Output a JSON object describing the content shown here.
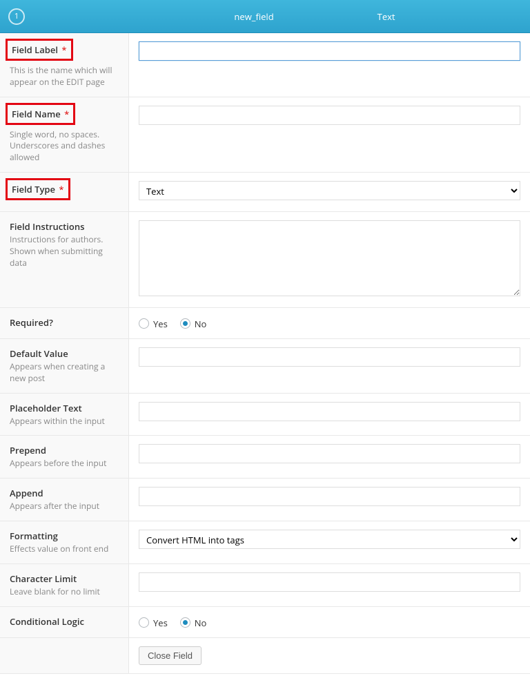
{
  "header": {
    "badge": "1",
    "name_col": "new_field",
    "type_col": "Text"
  },
  "rows": {
    "field_label": {
      "title": "Field Label",
      "required": "*",
      "desc": "This is the name which will appear on the EDIT page",
      "value": ""
    },
    "field_name": {
      "title": "Field Name",
      "required": "*",
      "desc": "Single word, no spaces. Underscores and dashes allowed",
      "value": ""
    },
    "field_type": {
      "title": "Field Type",
      "required": "*",
      "selected": "Text"
    },
    "instructions": {
      "title": "Field Instructions",
      "desc": "Instructions for authors. Shown when submitting data",
      "value": ""
    },
    "required_q": {
      "title": "Required?",
      "yes": "Yes",
      "no": "No",
      "selected": "no"
    },
    "default_value": {
      "title": "Default Value",
      "desc": "Appears when creating a new post",
      "value": ""
    },
    "placeholder_text": {
      "title": "Placeholder Text",
      "desc": "Appears within the input",
      "value": ""
    },
    "prepend": {
      "title": "Prepend",
      "desc": "Appears before the input",
      "value": ""
    },
    "append": {
      "title": "Append",
      "desc": "Appears after the input",
      "value": ""
    },
    "formatting": {
      "title": "Formatting",
      "desc": "Effects value on front end",
      "selected": "Convert HTML into tags"
    },
    "char_limit": {
      "title": "Character Limit",
      "desc": "Leave blank for no limit",
      "value": ""
    },
    "conditional": {
      "title": "Conditional Logic",
      "yes": "Yes",
      "no": "No",
      "selected": "no"
    }
  },
  "footer": {
    "close_btn": "Close Field"
  }
}
